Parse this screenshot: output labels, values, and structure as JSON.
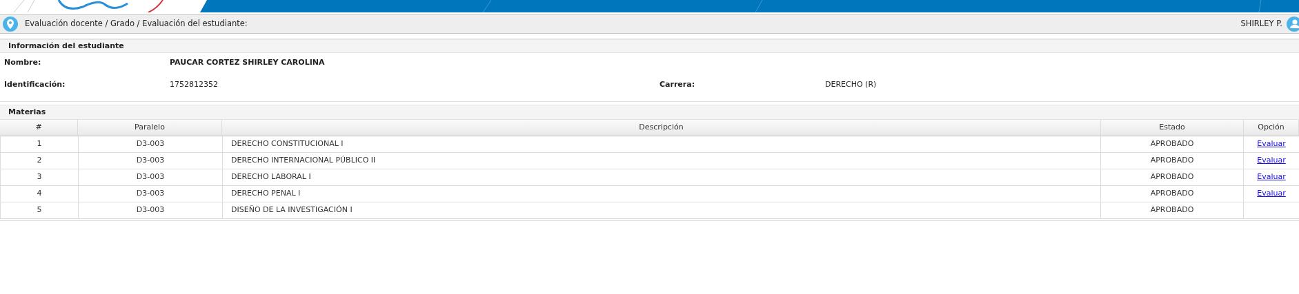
{
  "breadcrumb": "Evaluación docente / Grado / Evaluación del estudiante:",
  "user": "SHIRLEY P.",
  "student_info": {
    "title": "Información del estudiante",
    "fields": [
      {
        "label": "Nombre:",
        "value": "PAUCAR CORTEZ SHIRLEY CAROLINA",
        "bold": true
      },
      {
        "label": "Identificación:",
        "value": "1752812352",
        "bold": false
      },
      {
        "label": "Carrera:",
        "value": "DERECHO (R)",
        "bold": false
      }
    ]
  },
  "subjects": {
    "title": "Materias",
    "columns": [
      "#",
      "Paralelo",
      "Descripción",
      "Estado",
      "Opción"
    ],
    "rows": [
      {
        "cells": [
          "1",
          "D3-003",
          "DERECHO CONSTITUCIONAL I",
          "APROBADO"
        ],
        "action": "Evaluar"
      },
      {
        "cells": [
          "2",
          "D3-003",
          "DERECHO INTERNACIONAL PÚBLICO II",
          "APROBADO"
        ],
        "action": "Evaluar"
      },
      {
        "cells": [
          "3",
          "D3-003",
          "DERECHO LABORAL I",
          "APROBADO"
        ],
        "action": "Evaluar"
      },
      {
        "cells": [
          "4",
          "D3-003",
          "DERECHO PENAL I",
          "APROBADO"
        ],
        "action": "Evaluar"
      },
      {
        "cells": [
          "5",
          "D3-003",
          "DISEÑO DE LA INVESTIGACIÓN I",
          "APROBADO"
        ]
      }
    ]
  }
}
